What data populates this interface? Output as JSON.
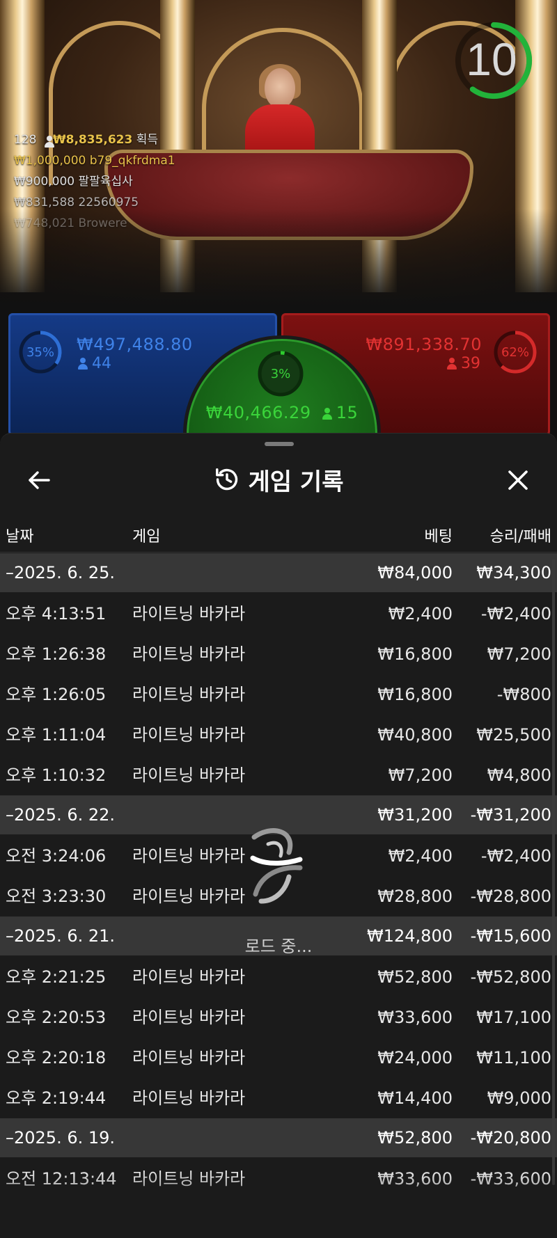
{
  "timer": {
    "value": "10",
    "remaining_fraction": 0.6
  },
  "winners": {
    "header_count": "128",
    "header_amount": "₩8,835,623",
    "header_label": "획득",
    "rows": [
      {
        "amount": "₩1,000,000",
        "name": "b79_qkfrdma1"
      },
      {
        "amount": "₩900,000",
        "name": "팔팔육십사"
      },
      {
        "amount": "₩831,588",
        "name": "22560975"
      },
      {
        "amount": "₩748,021",
        "name": "Browere"
      }
    ]
  },
  "bets": {
    "player": {
      "percent": "35%",
      "percent_value": 0.35,
      "amount": "₩497,488.80",
      "count": "44",
      "color": "#2e6fd6"
    },
    "banker": {
      "percent": "62%",
      "percent_value": 0.62,
      "amount": "₩891,338.70",
      "count": "39",
      "color": "#d42a2a"
    },
    "tie": {
      "percent": "3%",
      "percent_value": 0.03,
      "amount": "₩40,466.29",
      "count": "15",
      "color": "#2ecc2e"
    }
  },
  "history": {
    "title": "게임 기록",
    "columns": {
      "date": "날짜",
      "game": "게임",
      "bet": "베팅",
      "result": "승리/패배"
    },
    "groups": [
      {
        "date": "–2025. 6. 25.",
        "bet": "₩84,000",
        "result": "₩34,300",
        "items": [
          {
            "time": "오후 4:13:51",
            "game": "라이트닝 바카라",
            "bet": "₩2,400",
            "result": "-₩2,400"
          },
          {
            "time": "오후 1:26:38",
            "game": "라이트닝 바카라",
            "bet": "₩16,800",
            "result": "₩7,200"
          },
          {
            "time": "오후 1:26:05",
            "game": "라이트닝 바카라",
            "bet": "₩16,800",
            "result": "-₩800"
          },
          {
            "time": "오후 1:11:04",
            "game": "라이트닝 바카라",
            "bet": "₩40,800",
            "result": "₩25,500"
          },
          {
            "time": "오후 1:10:32",
            "game": "라이트닝 바카라",
            "bet": "₩7,200",
            "result": "₩4,800"
          }
        ]
      },
      {
        "date": "–2025. 6. 22.",
        "bet": "₩31,200",
        "result": "-₩31,200",
        "items": [
          {
            "time": "오전 3:24:06",
            "game": "라이트닝 바카라",
            "bet": "₩2,400",
            "result": "-₩2,400"
          },
          {
            "time": "오전 3:23:30",
            "game": "라이트닝 바카라",
            "bet": "₩28,800",
            "result": "-₩28,800"
          }
        ]
      },
      {
        "date": "–2025. 6. 21.",
        "bet": "₩124,800",
        "result": "-₩15,600",
        "items": [
          {
            "time": "오후 2:21:25",
            "game": "라이트닝 바카라",
            "bet": "₩52,800",
            "result": "-₩52,800"
          },
          {
            "time": "오후 2:20:53",
            "game": "라이트닝 바카라",
            "bet": "₩33,600",
            "result": "₩17,100"
          },
          {
            "time": "오후 2:20:18",
            "game": "라이트닝 바카라",
            "bet": "₩24,000",
            "result": "₩11,100"
          },
          {
            "time": "오후 2:19:44",
            "game": "라이트닝 바카라",
            "bet": "₩14,400",
            "result": "₩9,000"
          }
        ]
      },
      {
        "date": "–2025. 6. 19.",
        "bet": "₩52,800",
        "result": "-₩20,800",
        "items": [
          {
            "time": "오전 12:13:44",
            "game": "라이트닝 바카라",
            "bet": "₩33,600",
            "result": "-₩33,600"
          }
        ]
      }
    ],
    "loading_text": "로드 중..."
  },
  "icons": {
    "back": "arrow-left-icon",
    "history": "history-icon",
    "close": "close-icon",
    "loader": "loading-spinner-icon",
    "person": "person-icon"
  }
}
